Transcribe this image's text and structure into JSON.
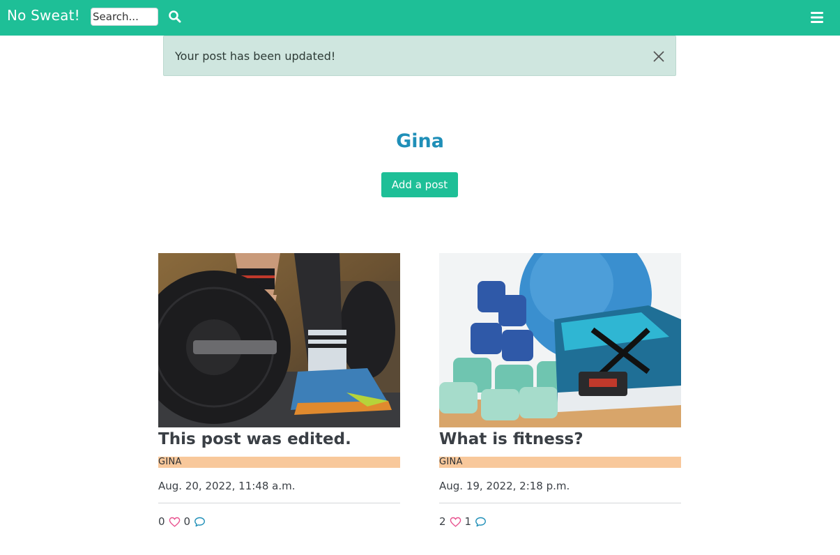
{
  "navbar": {
    "brand": "No Sweat!",
    "search_placeholder": "Search...",
    "search_icon": "search-icon",
    "menu_icon": "hamburger-menu-icon"
  },
  "alert": {
    "message": "Your post has been updated!",
    "close_icon": "close-icon"
  },
  "profile": {
    "name": "Gina",
    "add_post_label": "Add a post"
  },
  "posts": [
    {
      "title": "This post was edited.",
      "author": "GINA",
      "date": "Aug. 20, 2022, 11:48 a.m.",
      "likes": "0",
      "comments": "0",
      "image": "barbell-plate-gym-photo"
    },
    {
      "title": "What is fitness?",
      "author": "GINA",
      "date": "Aug. 19, 2022, 2:18 p.m.",
      "likes": "2",
      "comments": "1",
      "image": "dumbbells-and-running-shoe-photo"
    }
  ],
  "colors": {
    "brand_green": "#1ebf97",
    "alert_bg": "#cfe6df",
    "profile_name": "#1f8fb8",
    "author_band": "#f8c89b",
    "heart": "#e8538f",
    "comment": "#1f8fb8"
  }
}
